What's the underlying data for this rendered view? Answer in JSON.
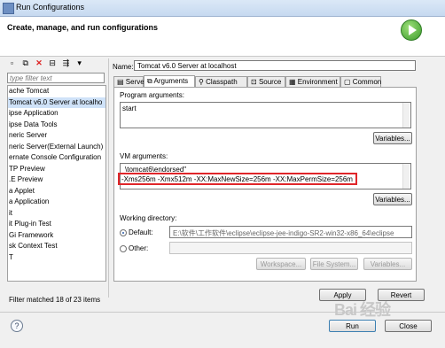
{
  "window": {
    "title": "Run Configurations"
  },
  "header": {
    "title": "Create, manage, and run configurations"
  },
  "sidebar": {
    "filter_placeholder": "type filter text",
    "items": [
      "ache Tomcat",
      " Tomcat v6.0 Server at localho",
      "ipse Application",
      "ipse Data Tools",
      "neric Server",
      "neric Server(External Launch)",
      "ernate Console Configuration",
      "TP Preview",
      ".E Preview",
      "a Applet",
      "a Application",
      "it",
      "it Plug-in Test",
      "Gi Framework",
      "sk Context Test",
      "T"
    ],
    "selected_index": 1,
    "footer": "Filter matched 18 of 23 items"
  },
  "config": {
    "name_label": "Name:",
    "name_value": "Tomcat v6.0 Server at localhost",
    "tabs": [
      "Server",
      "Arguments",
      "Classpath",
      "Source",
      "Environment",
      "Common"
    ],
    "active_tab": 1,
    "program_args_label": "Program arguments:",
    "program_args_value": "start",
    "variables1": "Variables...",
    "vm_args_label": "VM arguments:",
    "vm_args_line1": "\\tomcat6\\endorsed\"",
    "vm_args_line2": "-Xms256m -Xmx512m -XX:MaxNewSize=256m -XX:MaxPermSize=256m",
    "variables2": "Variables...",
    "working_dir_label": "Working directory:",
    "default_label": "Default:",
    "default_value": "E:\\软件\\工作软件\\eclipse\\eclipse-jee-indigo-SR2-win32-x86_64\\eclipse",
    "other_label": "Other:",
    "workspace_btn": "Workspace...",
    "filesystem_btn": "File System...",
    "variables3": "Variables...",
    "apply": "Apply",
    "revert": "Revert"
  },
  "footer": {
    "run": "Run",
    "close": "Close",
    "watermark": "Bai 经验"
  },
  "colors": {
    "highlight_box": "#e0262a",
    "selection": "#cfe2f8"
  }
}
